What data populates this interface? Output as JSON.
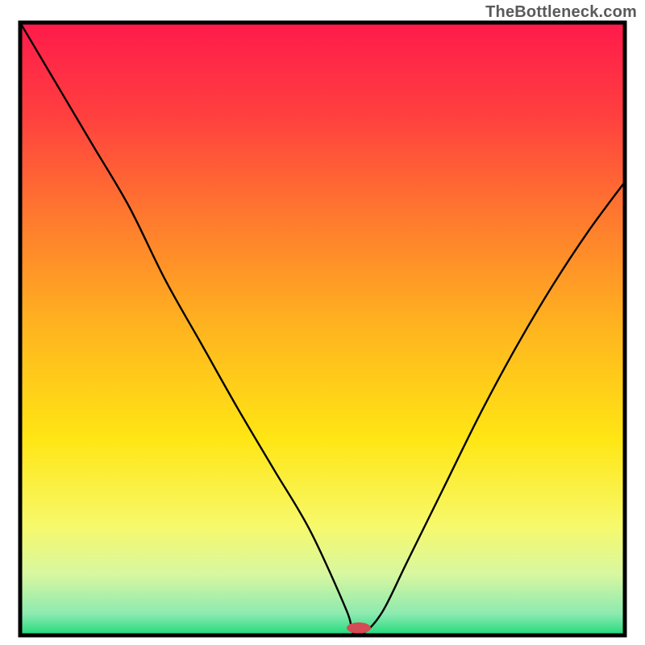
{
  "watermark": "TheBottleneck.com",
  "chart_data": {
    "type": "line",
    "title": "",
    "xlabel": "",
    "ylabel": "",
    "xlim": [
      0,
      100
    ],
    "ylim": [
      0,
      100
    ],
    "grid": false,
    "legend": false,
    "gradient_stops": [
      {
        "offset": 0.0,
        "color": "#ff1a4b"
      },
      {
        "offset": 0.15,
        "color": "#ff3f3f"
      },
      {
        "offset": 0.32,
        "color": "#ff7a2e"
      },
      {
        "offset": 0.5,
        "color": "#ffb51f"
      },
      {
        "offset": 0.68,
        "color": "#ffe614"
      },
      {
        "offset": 0.82,
        "color": "#f7f96a"
      },
      {
        "offset": 0.9,
        "color": "#d8f7a0"
      },
      {
        "offset": 0.965,
        "color": "#8ceab0"
      },
      {
        "offset": 1.0,
        "color": "#1ed97a"
      }
    ],
    "series": [
      {
        "name": "bottleneck-curve",
        "x": [
          0,
          6,
          12,
          18,
          24,
          30,
          36,
          42,
          48,
          54,
          55,
          57,
          60,
          64,
          70,
          76,
          82,
          88,
          94,
          100
        ],
        "y": [
          100,
          90,
          80,
          70,
          58,
          47.5,
          37,
          27,
          17,
          4,
          0.5,
          0.5,
          4,
          12,
          24,
          36,
          47,
          57,
          66,
          74
        ]
      }
    ],
    "marker": {
      "x": 56,
      "y": 1.2,
      "rx": 2.0,
      "ry": 0.9,
      "color": "#d44a55"
    },
    "frame_color": "#000000",
    "frame_width": 5,
    "curve_color": "#000000",
    "curve_width": 2.4
  }
}
